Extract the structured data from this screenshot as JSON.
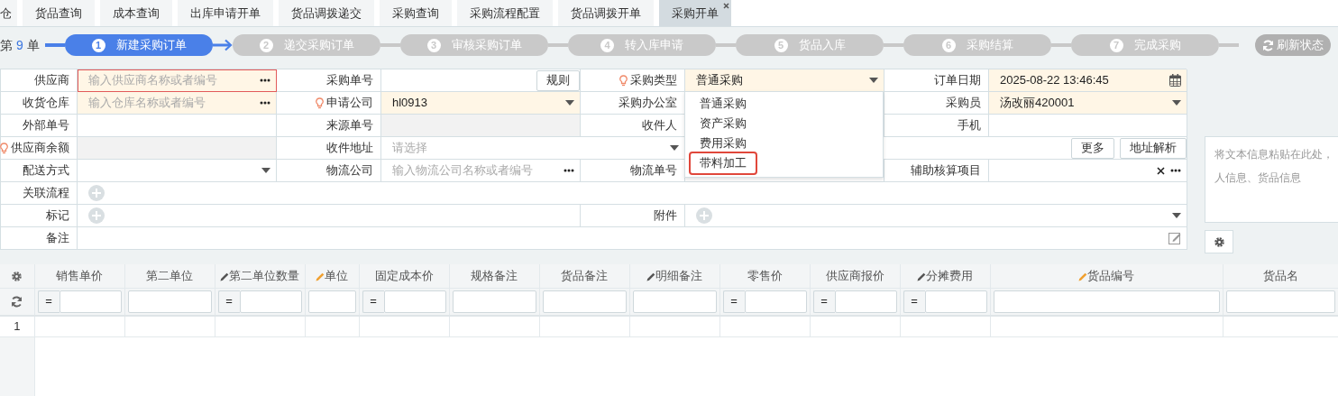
{
  "tabs": [
    {
      "label": "仓",
      "selected": false,
      "closable": false
    },
    {
      "label": "货品查询",
      "selected": false,
      "closable": false
    },
    {
      "label": "成本查询",
      "selected": false,
      "closable": false
    },
    {
      "label": "出库申请开单",
      "selected": false,
      "closable": false
    },
    {
      "label": "货品调拨递交",
      "selected": false,
      "closable": false
    },
    {
      "label": "采购查询",
      "selected": false,
      "closable": false
    },
    {
      "label": "采购流程配置",
      "selected": false,
      "closable": false
    },
    {
      "label": "货品调拨开单",
      "selected": false,
      "closable": false
    },
    {
      "label": "采购开单",
      "selected": true,
      "closable": true
    }
  ],
  "order_count": {
    "prefix": "第",
    "number": "9",
    "suffix": "单"
  },
  "steps": [
    {
      "number": "1",
      "label": "新建采购订单",
      "selected": true
    },
    {
      "number": "2",
      "label": "递交采购订单",
      "selected": false
    },
    {
      "number": "3",
      "label": "审核采购订单",
      "selected": false
    },
    {
      "number": "4",
      "label": "转入库申请",
      "selected": false
    },
    {
      "number": "5",
      "label": "货品入库",
      "selected": false
    },
    {
      "number": "6",
      "label": "采购结算",
      "selected": false
    },
    {
      "number": "7",
      "label": "完成采购",
      "selected": false
    }
  ],
  "refresh_button": "刷新状态",
  "form": {
    "rows": [
      [
        {
          "kind": "label",
          "text": "供应商",
          "hint": false
        },
        {
          "kind": "field",
          "required": true,
          "error": true,
          "placeholder": "输入供应商名称或者编号",
          "more": true
        },
        {
          "kind": "label",
          "text": "采购单号",
          "hint": false
        },
        {
          "kind": "field",
          "button": "规则"
        },
        {
          "kind": "label",
          "text": "采购类型",
          "hint": true
        },
        {
          "kind": "field",
          "required": true,
          "value": "普通采购",
          "dropdown": true
        },
        {
          "kind": "label",
          "text": "订单日期",
          "hint": false
        },
        {
          "kind": "field",
          "required": true,
          "value": "2025-08-22 13:46:45",
          "calendar": true
        }
      ],
      [
        {
          "kind": "label",
          "text": "收货仓库",
          "hint": false
        },
        {
          "kind": "field",
          "required": true,
          "placeholder": "输入仓库名称或者编号",
          "more": true
        },
        {
          "kind": "label",
          "text": "申请公司",
          "hint": true
        },
        {
          "kind": "field",
          "required": true,
          "value": "hl0913",
          "dropdown": true
        },
        {
          "kind": "label",
          "text": "采购办公室",
          "hint": false
        },
        {
          "kind": "field"
        },
        {
          "kind": "label",
          "text": "采购员",
          "hint": false
        },
        {
          "kind": "field",
          "required": true,
          "value": "汤改丽420001",
          "dropdown": true
        }
      ],
      [
        {
          "kind": "label",
          "text": "外部单号",
          "hint": false
        },
        {
          "kind": "field"
        },
        {
          "kind": "label",
          "text": "来源单号",
          "hint": false
        },
        {
          "kind": "field",
          "readonly": true
        },
        {
          "kind": "label",
          "text": "收件人",
          "hint": false
        },
        {
          "kind": "field"
        },
        {
          "kind": "label",
          "text": "手机",
          "hint": false
        },
        {
          "kind": "field"
        }
      ],
      [
        {
          "kind": "label",
          "text": "供应商余额",
          "hint": true
        },
        {
          "kind": "field",
          "readonly": true
        },
        {
          "kind": "label",
          "text": "收件地址",
          "hint": false
        },
        {
          "kind": "field",
          "placeholder": "请选择",
          "dropdown": true
        },
        "",
        {
          "kind": "actions",
          "buttons": [
            "更多",
            "地址解析"
          ]
        },
        "",
        ""
      ],
      [
        {
          "kind": "label",
          "text": "配送方式",
          "hint": false
        },
        {
          "kind": "field",
          "dropdown": true
        },
        {
          "kind": "label",
          "text": "物流公司",
          "hint": false
        },
        {
          "kind": "field",
          "placeholder": "输入物流公司名称或者编号",
          "more": true
        },
        {
          "kind": "label",
          "text": "物流单号",
          "hint": false
        },
        {
          "kind": "field"
        },
        {
          "kind": "label",
          "text": "辅助核算项目",
          "hint": false
        },
        {
          "kind": "field",
          "clearable": true,
          "more": true
        }
      ],
      [
        {
          "kind": "label",
          "text": "关联流程",
          "hint": false
        },
        {
          "kind": "field",
          "add": true
        },
        "",
        "",
        "",
        "",
        "",
        ""
      ],
      [
        {
          "kind": "label",
          "text": "标记",
          "hint": false
        },
        {
          "kind": "field",
          "add": true
        },
        "",
        "",
        {
          "kind": "label",
          "text": "附件",
          "hint": false
        },
        {
          "kind": "field",
          "add": true,
          "dropdown": true
        },
        "",
        ""
      ],
      [
        {
          "kind": "label",
          "text": "备注",
          "hint": false
        },
        {
          "kind": "field",
          "editor": true
        },
        "",
        "",
        "",
        "",
        "",
        ""
      ]
    ]
  },
  "type_dropdown": {
    "options": [
      {
        "label": "普通采购",
        "highlighted": false
      },
      {
        "label": "资产采购",
        "highlighted": false
      },
      {
        "label": "费用采购",
        "highlighted": false
      },
      {
        "label": "带料加工",
        "highlighted": true
      }
    ]
  },
  "paste_box": {
    "placeholder_lines": [
      "将文本信息粘贴在此处，",
      "人信息、货品信息"
    ]
  },
  "grid": {
    "columns": [
      {
        "label": "销售单价",
        "editable": false,
        "has_operator": true
      },
      {
        "label": "第二单位",
        "editable": false,
        "has_operator": false
      },
      {
        "label": "第二单位数量",
        "editable": true,
        "color": "#555555",
        "has_operator": true
      },
      {
        "label": "单位",
        "editable": true,
        "color": "#f0a030",
        "has_operator": false
      },
      {
        "label": "固定成本价",
        "editable": false,
        "has_operator": true
      },
      {
        "label": "规格备注",
        "editable": false,
        "has_operator": false
      },
      {
        "label": "货品备注",
        "editable": false,
        "has_operator": false
      },
      {
        "label": "明细备注",
        "editable": true,
        "color": "#555555",
        "has_operator": false
      },
      {
        "label": "零售价",
        "editable": false,
        "has_operator": true
      },
      {
        "label": "供应商报价",
        "editable": false,
        "has_operator": true
      },
      {
        "label": "分摊费用",
        "editable": true,
        "color": "#555555",
        "has_operator": true
      },
      {
        "label": "货品编号",
        "editable": true,
        "color": "#f0a030",
        "has_operator": false
      },
      {
        "label": "货品名",
        "editable": false,
        "has_operator": false
      }
    ],
    "filter_operator": "=",
    "rows": [
      "1"
    ]
  }
}
